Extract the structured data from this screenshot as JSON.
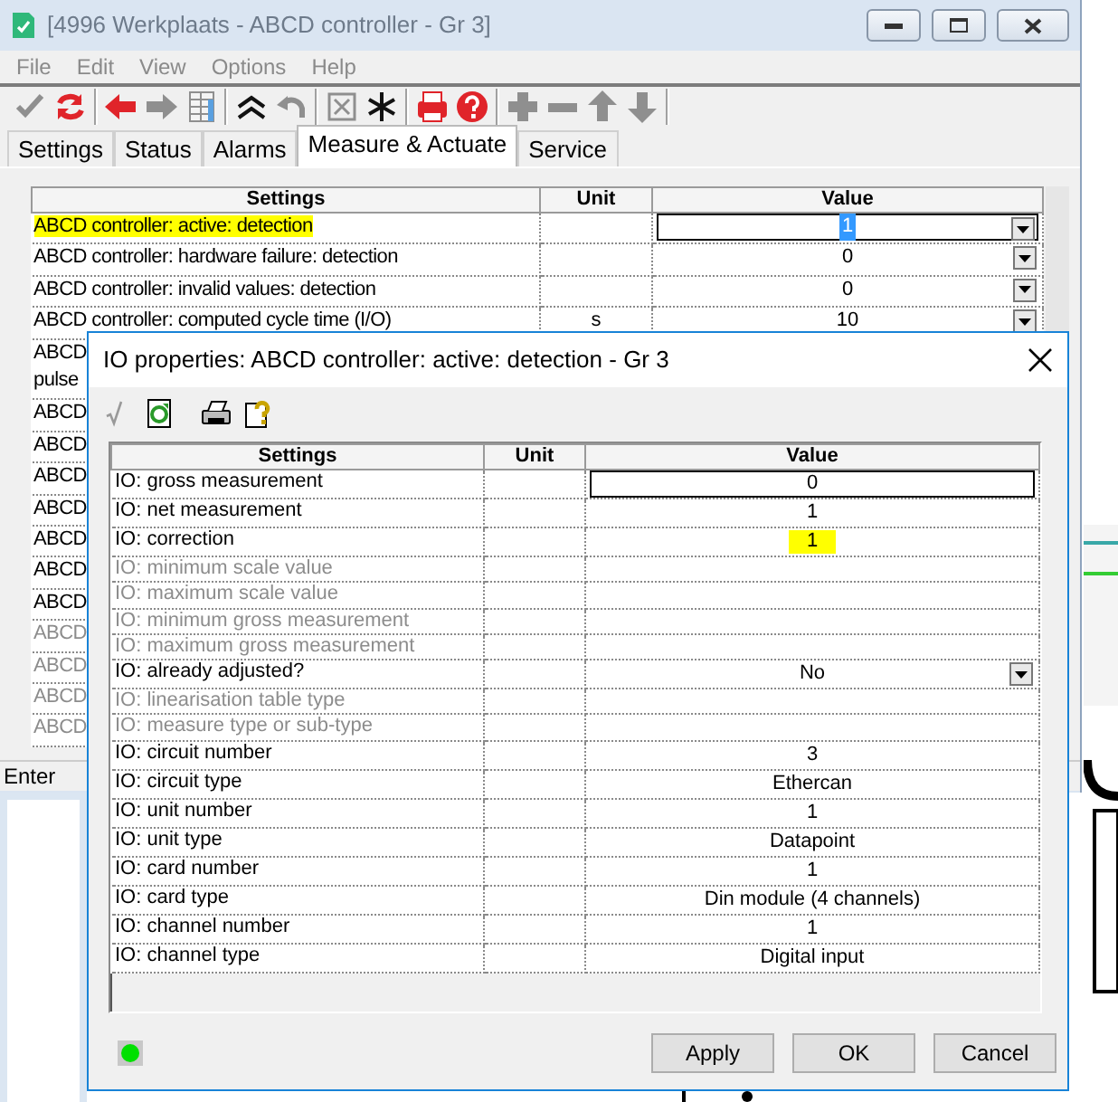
{
  "main_window": {
    "title": "[4996 Werkplaats - ABCD controller - Gr 3]",
    "active": false,
    "menu": [
      "File",
      "Edit",
      "View",
      "Options",
      "Help"
    ],
    "toolbar": [
      {
        "kind": "check",
        "disabled": true
      },
      {
        "kind": "refresh",
        "disabled": false
      },
      {
        "kind": "separator"
      },
      {
        "kind": "back",
        "disabled": false
      },
      {
        "kind": "forward",
        "disabled": true
      },
      {
        "kind": "columns",
        "disabled": true
      },
      {
        "kind": "separator"
      },
      {
        "kind": "collapse",
        "disabled": false
      },
      {
        "kind": "undo",
        "disabled": true
      },
      {
        "kind": "separator"
      },
      {
        "kind": "boxx",
        "disabled": true
      },
      {
        "kind": "asterisk",
        "disabled": false
      },
      {
        "kind": "separator"
      },
      {
        "kind": "print",
        "disabled": false
      },
      {
        "kind": "help",
        "disabled": false
      },
      {
        "kind": "separator"
      },
      {
        "kind": "plus",
        "disabled": true
      },
      {
        "kind": "minus",
        "disabled": true
      },
      {
        "kind": "up",
        "disabled": true
      },
      {
        "kind": "down",
        "disabled": true
      },
      {
        "kind": "separator"
      }
    ],
    "tabs": [
      {
        "label": "Settings",
        "selected": false
      },
      {
        "label": "Status",
        "selected": false
      },
      {
        "label": "Alarms",
        "selected": false
      },
      {
        "label": "Measure & Actuate",
        "selected": true
      },
      {
        "label": "Service",
        "selected": false
      }
    ],
    "table": {
      "columns": [
        "Settings",
        "Unit",
        "Value"
      ],
      "rows": [
        {
          "lines": [
            "ABCD controller: active: detection"
          ],
          "value": "1",
          "dropdown": true,
          "highlighted": true,
          "focused": true,
          "disabled": false
        },
        {
          "lines": [
            "ABCD controller: hardware failure: detection"
          ],
          "value": "0",
          "dropdown": true,
          "disabled": false
        },
        {
          "lines": [
            "ABCD controller: invalid values: detection"
          ],
          "value": "0",
          "dropdown": true,
          "disabled": false
        },
        {
          "lines": [
            "ABCD controller: computed cycle time (I/O)"
          ],
          "unit": "s",
          "value": "10",
          "dropdown": true,
          "disabled": false
        },
        {
          "lines": [
            "ABCD",
            "pulse"
          ],
          "disabled": false
        },
        {
          "lines": [
            "ABCD"
          ],
          "disabled": false
        },
        {
          "lines": [
            "ABCD"
          ],
          "disabled": false
        },
        {
          "lines": [
            "ABCD"
          ],
          "disabled": false
        },
        {
          "lines": [
            "ABCD"
          ],
          "disabled": false
        },
        {
          "lines": [
            "ABCD"
          ],
          "disabled": false
        },
        {
          "lines": [
            "ABCD"
          ],
          "disabled": false
        },
        {
          "lines": [
            "ABCD"
          ],
          "disabled": false
        },
        {
          "lines": [
            "ABCD"
          ],
          "disabled": true
        },
        {
          "lines": [
            "ABCD"
          ],
          "disabled": true
        },
        {
          "lines": [
            "ABCD"
          ],
          "disabled": true
        },
        {
          "lines": [
            "ABCD"
          ],
          "disabled": true
        }
      ]
    },
    "status_bar": "Enter"
  },
  "dialog": {
    "title": "IO properties: ABCD controller: active: detection - Gr 3",
    "toolbar": [
      {
        "kind": "sqrt",
        "disabled": true
      },
      {
        "kind": "refresh-doc",
        "disabled": false
      },
      {
        "kind": "print",
        "disabled": false
      },
      {
        "kind": "help-doc",
        "disabled": false
      }
    ],
    "table": {
      "columns": [
        "Settings",
        "Unit",
        "Value"
      ],
      "rows": [
        {
          "label": "IO: gross measurement",
          "value": "0",
          "disabled": false,
          "focused": true
        },
        {
          "label": "IO: net measurement",
          "value": "1",
          "disabled": false
        },
        {
          "label": "IO: correction",
          "value": "1",
          "disabled": false,
          "highlighted": true
        },
        {
          "label": "IO: minimum scale value",
          "disabled": true
        },
        {
          "label": "IO: maximum scale value",
          "disabled": true
        },
        {
          "label": "IO: minimum gross measurement",
          "disabled": true
        },
        {
          "label": "IO: maximum gross measurement",
          "disabled": true
        },
        {
          "label": "IO: already adjusted?",
          "value": "No",
          "disabled": false,
          "dropdown": true
        },
        {
          "label": "IO: linearisation table type",
          "disabled": true
        },
        {
          "label": "IO: measure type or sub-type",
          "disabled": true
        },
        {
          "label": "IO: circuit number",
          "value": "3",
          "disabled": false
        },
        {
          "label": "IO: circuit type",
          "value": "Ethercan",
          "disabled": false
        },
        {
          "label": "IO: unit number",
          "value": "1",
          "disabled": false
        },
        {
          "label": "IO: unit type",
          "value": "Datapoint",
          "disabled": false
        },
        {
          "label": "IO: card number",
          "value": "1",
          "disabled": false
        },
        {
          "label": "IO: card type",
          "value": "Din module (4 channels)",
          "disabled": false
        },
        {
          "label": "IO: channel number",
          "value": "1",
          "disabled": false
        },
        {
          "label": "IO: channel type",
          "value": "Digital input",
          "disabled": false
        }
      ]
    },
    "status_led": {
      "on": true
    },
    "buttons": [
      "Apply",
      "OK",
      "Cancel"
    ]
  }
}
